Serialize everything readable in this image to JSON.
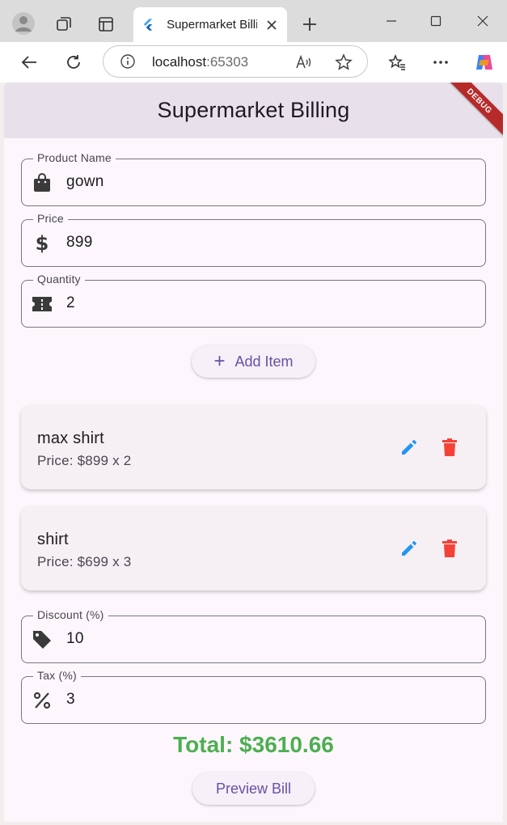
{
  "browser": {
    "tab_title": "Supermarket Billing",
    "url_host": "localhost",
    "url_port": ":65303"
  },
  "app": {
    "title": "Supermarket Billing",
    "debug_label": "DEBUG"
  },
  "form": {
    "product_name": {
      "label": "Product Name",
      "value": "gown",
      "icon": "shopping-bag-icon"
    },
    "price": {
      "label": "Price",
      "value": "899",
      "icon": "dollar-icon"
    },
    "quantity": {
      "label": "Quantity",
      "value": "2",
      "icon": "ticket-icon"
    }
  },
  "add_item_label": "Add Item",
  "items": [
    {
      "name": "max shirt",
      "price_line": "Price: $899 x 2"
    },
    {
      "name": "shirt",
      "price_line": "Price: $699 x 3"
    }
  ],
  "discount": {
    "label": "Discount (%)",
    "value": "10",
    "icon": "tag-icon"
  },
  "tax": {
    "label": "Tax (%)",
    "value": "3",
    "icon": "percent-icon"
  },
  "total_text": "Total: $3610.66",
  "preview_label": "Preview Bill",
  "colors": {
    "accent": "#6750a4",
    "edit": "#2196f3",
    "delete": "#f44336",
    "total": "#4caf50"
  }
}
